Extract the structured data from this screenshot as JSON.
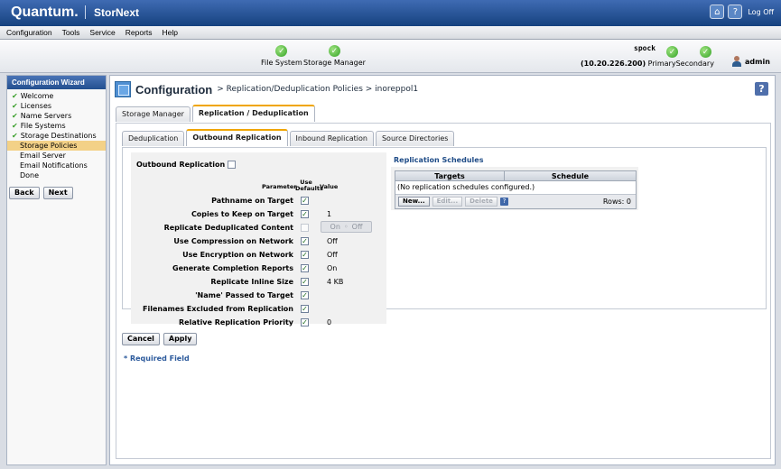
{
  "header": {
    "brand": "Quantum.",
    "product": "StorNext",
    "logoff": "Log Off"
  },
  "menu": [
    "Configuration",
    "Tools",
    "Service",
    "Reports",
    "Help"
  ],
  "status": {
    "file_system": "File System",
    "storage_manager": "Storage Manager",
    "host": "spock",
    "host_ip": "(10.20.226.200)",
    "primary": "Primary",
    "secondary": "Secondary",
    "user": "admin"
  },
  "sidebar": {
    "title": "Configuration Wizard",
    "items": [
      {
        "label": "Welcome",
        "checked": true
      },
      {
        "label": "Licenses",
        "checked": true
      },
      {
        "label": "Name Servers",
        "checked": true
      },
      {
        "label": "File Systems",
        "checked": true
      },
      {
        "label": "Storage Destinations",
        "checked": true
      },
      {
        "label": "Storage Policies",
        "checked": false,
        "selected": true
      },
      {
        "label": "Email Server",
        "checked": false
      },
      {
        "label": "Email Notifications",
        "checked": false
      },
      {
        "label": "Done",
        "checked": false
      }
    ],
    "back_label": "Back",
    "next_label": "Next"
  },
  "page": {
    "title": "Configuration",
    "breadcrumb": "> Replication/Deduplication Policies > inoreppol1"
  },
  "tabs": [
    "Storage Manager",
    "Replication / Deduplication"
  ],
  "subtabs": [
    "Deduplication",
    "Outbound Replication",
    "Inbound Replication",
    "Source Directories"
  ],
  "outbound": {
    "label": "Outbound Replication",
    "col_param": "Parameter",
    "col_use": "Use",
    "col_defaults": "Defaults",
    "col_value": "Value",
    "rows": [
      {
        "label": "Pathname on Target",
        "checked": true,
        "value": ""
      },
      {
        "label": "Copies to Keep on Target",
        "checked": true,
        "value": "1"
      },
      {
        "label": "Replicate Deduplicated Content",
        "checked": false,
        "value": "",
        "toggle_on": "On",
        "toggle_off": "Off"
      },
      {
        "label": "Use Compression on Network",
        "checked": true,
        "value": "Off"
      },
      {
        "label": "Use Encryption on Network",
        "checked": true,
        "value": "Off"
      },
      {
        "label": "Generate Completion Reports",
        "checked": true,
        "value": "On"
      },
      {
        "label": "Replicate Inline Size",
        "checked": true,
        "value": "4 KB"
      },
      {
        "label": "'Name' Passed to Target",
        "checked": true,
        "value": ""
      },
      {
        "label": "Filenames Excluded from Replication",
        "checked": true,
        "value": ""
      },
      {
        "label": "Relative Replication Priority",
        "checked": true,
        "value": "0"
      }
    ]
  },
  "schedules": {
    "title": "Replication Schedules",
    "col_targets": "Targets",
    "col_schedule": "Schedule",
    "empty": "(No replication schedules configured.)",
    "new_label": "New...",
    "edit_label": "Edit...",
    "delete_label": "Delete",
    "rows_label": "Rows: 0"
  },
  "actions": {
    "cancel_label": "Cancel",
    "apply_label": "Apply",
    "required": "* Required Field"
  }
}
